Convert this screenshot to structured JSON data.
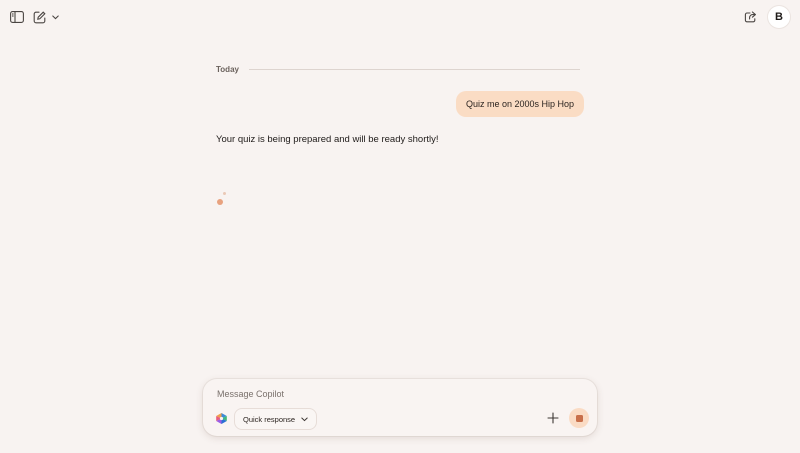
{
  "header": {
    "sidebar_toggle_icon": "sidebar-panel-icon",
    "new_chat_icon": "compose-icon",
    "new_chat_dropdown_icon": "chevron-down-icon",
    "share_icon": "share-icon",
    "avatar_initial": "B"
  },
  "conversation": {
    "date_label": "Today",
    "user_message": "Quiz me on 2000s Hip Hop",
    "assistant_message": "Your quiz is being prepared and will be ready shortly!"
  },
  "composer": {
    "placeholder": "Message Copilot",
    "mode_label": "Quick response",
    "logo_icon": "copilot-logo-icon",
    "add_icon": "plus-icon",
    "stop_icon": "stop-icon"
  },
  "colors": {
    "background": "#f8f3f1",
    "user_bubble": "#fadcc4",
    "accent": "#c86f4a"
  }
}
